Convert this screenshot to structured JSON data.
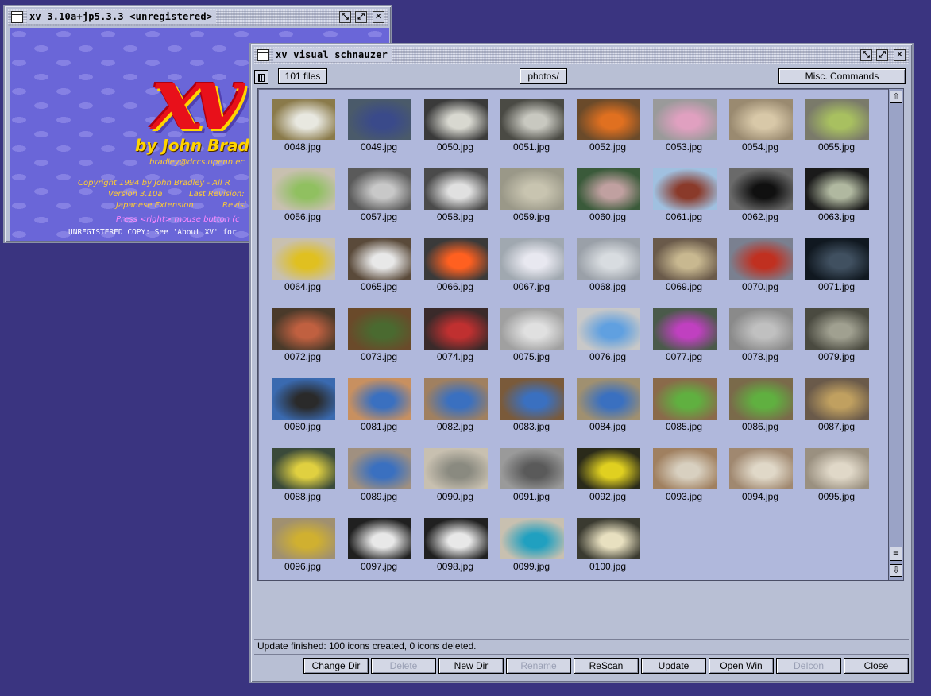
{
  "splash": {
    "title": "xv 3.10a+jp5.3.3 <unregistered>",
    "logo_text": "xv",
    "byline": "by John Bradl",
    "email": "bradley@dccs.upenn.ec",
    "copyright": "Copyright 1994 by John Bradley - All R",
    "version": "Version 3.10a",
    "last_revision": "Last Revision:",
    "jp_ext": "Japanese Extension",
    "revision2": "Revisi",
    "press": "Press <right> mouse button (c",
    "unregistered": "UNREGISTERED COPY:  See 'About XV' for"
  },
  "schnauzer": {
    "title": "xv visual schnauzer",
    "file_count": "101 files",
    "directory": "photos/",
    "misc_commands": "Misc. Commands",
    "status": "Update finished:  100 icons created, 0 icons deleted.",
    "buttons": {
      "change_dir": "Change Dir",
      "delete": "Delete",
      "new_dir": "New Dir",
      "rename": "Rename",
      "rescan": "ReScan",
      "update": "Update",
      "open_win": "Open Win",
      "deiconify": "DeIcon",
      "close": "Close"
    },
    "files": [
      "0048.jpg",
      "0049.jpg",
      "0050.jpg",
      "0051.jpg",
      "0052.jpg",
      "0053.jpg",
      "0054.jpg",
      "0055.jpg",
      "0056.jpg",
      "0057.jpg",
      "0058.jpg",
      "0059.jpg",
      "0060.jpg",
      "0061.jpg",
      "0062.jpg",
      "0063.jpg",
      "0064.jpg",
      "0065.jpg",
      "0066.jpg",
      "0067.jpg",
      "0068.jpg",
      "0069.jpg",
      "0070.jpg",
      "0071.jpg",
      "0072.jpg",
      "0073.jpg",
      "0074.jpg",
      "0075.jpg",
      "0076.jpg",
      "0077.jpg",
      "0078.jpg",
      "0079.jpg",
      "0080.jpg",
      "0081.jpg",
      "0082.jpg",
      "0083.jpg",
      "0084.jpg",
      "0085.jpg",
      "0086.jpg",
      "0087.jpg",
      "0088.jpg",
      "0089.jpg",
      "0090.jpg",
      "0091.jpg",
      "0092.jpg",
      "0093.jpg",
      "0094.jpg",
      "0095.jpg",
      "0096.jpg",
      "0097.jpg",
      "0098.jpg",
      "0099.jpg",
      "0100.jpg"
    ],
    "thumb_colors": [
      [
        "#8a7a4a",
        "#e8e8e0"
      ],
      [
        "#4a5a6a",
        "#3a4a8a"
      ],
      [
        "#3a3a3a",
        "#d8d8d0"
      ],
      [
        "#4a4a44",
        "#c8c8c0"
      ],
      [
        "#6a4a2a",
        "#e07020"
      ],
      [
        "#9a9a9a",
        "#e0a0c0"
      ],
      [
        "#9a8a70",
        "#d8c8a8"
      ],
      [
        "#7a7a6a",
        "#a8c060"
      ],
      [
        "#c8c0b0",
        "#90c060"
      ],
      [
        "#5a5a5a",
        "#c8c8c8"
      ],
      [
        "#4a4a4a",
        "#e0e0e0"
      ],
      [
        "#9a9888",
        "#c8c4b0"
      ],
      [
        "#3a5a3a",
        "#c0a0a0"
      ],
      [
        "#a0c0e0",
        "#8a3a2a"
      ],
      [
        "#6a6a6a",
        "#101010"
      ],
      [
        "#1a1a1a",
        "#b0b8a0"
      ],
      [
        "#c8c0b0",
        "#e0c020"
      ],
      [
        "#5a4a3a",
        "#e8e8e8"
      ],
      [
        "#3a3a3a",
        "#ff6020"
      ],
      [
        "#a0a8b0",
        "#e8e8f0"
      ],
      [
        "#9aa0a8",
        "#d8dce0"
      ],
      [
        "#6a5a4a",
        "#c8b890"
      ],
      [
        "#7a8090",
        "#c03020"
      ],
      [
        "#101820",
        "#405060"
      ],
      [
        "#4a3a2a",
        "#c06040"
      ],
      [
        "#6a4a2a",
        "#4a6a30"
      ],
      [
        "#3a2a2a",
        "#c03030"
      ],
      [
        "#a0a0a0",
        "#e0e0e0"
      ],
      [
        "#c8c8c8",
        "#60a0e0"
      ],
      [
        "#4a5a4a",
        "#c040c0"
      ],
      [
        "#8a8a8a",
        "#c0c0c0"
      ],
      [
        "#4a4a40",
        "#a0a090"
      ],
      [
        "#3a6ab0",
        "#2a2a2a"
      ],
      [
        "#c89060",
        "#3a70c0"
      ],
      [
        "#a08060",
        "#3a70c0"
      ],
      [
        "#7a5a3a",
        "#3a70c0"
      ],
      [
        "#a09070",
        "#3a70c0"
      ],
      [
        "#8a6a4a",
        "#60b040"
      ],
      [
        "#7a6a4a",
        "#60b040"
      ],
      [
        "#6a5a4a",
        "#c0a060"
      ],
      [
        "#3a4a3a",
        "#e0d040"
      ],
      [
        "#a09080",
        "#3a70c0"
      ],
      [
        "#c8c0b0",
        "#8a8a80"
      ],
      [
        "#9a9a9a",
        "#5a5a5a"
      ],
      [
        "#2a2a1a",
        "#e0d020"
      ],
      [
        "#a08060",
        "#d8d0c0"
      ],
      [
        "#a08870",
        "#e0d8c8"
      ],
      [
        "#9a9080",
        "#e0d8c8"
      ],
      [
        "#a09070",
        "#d0b030"
      ],
      [
        "#202020",
        "#e8e8e8"
      ],
      [
        "#202020",
        "#e8e8e8"
      ],
      [
        "#c8c0b0",
        "#20a0c0"
      ],
      [
        "#3a3a30",
        "#e8e0c0"
      ]
    ]
  }
}
